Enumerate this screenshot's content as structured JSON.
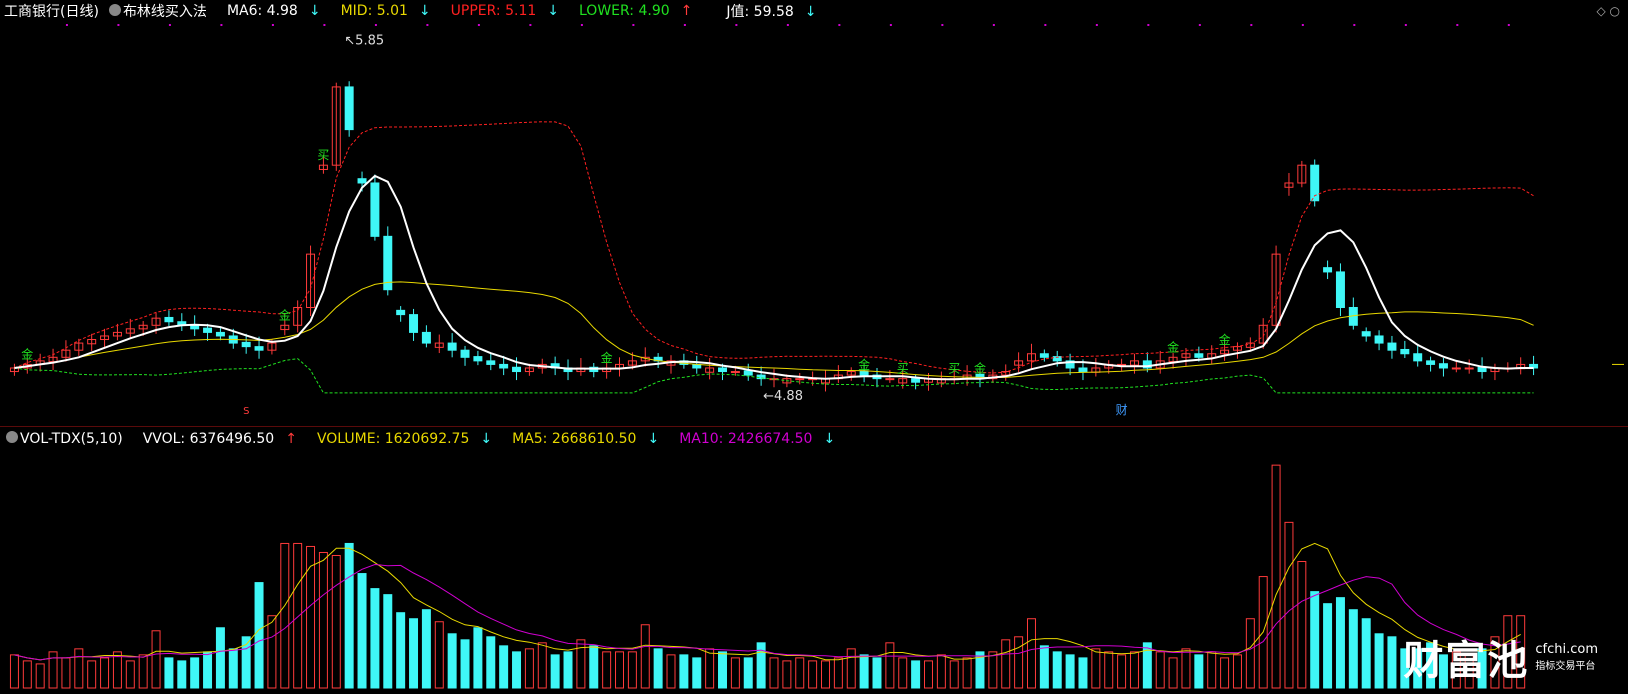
{
  "header": {
    "stock_name": "工商银行(日线)",
    "indicator": "布林线买入法",
    "ma6": {
      "label": "MA6: 4.98",
      "color": "#ffffff",
      "dir": "↓"
    },
    "mid": {
      "label": "MID: 5.01",
      "color": "#e8d800",
      "dir": "↓"
    },
    "upper": {
      "label": "UPPER: 5.11",
      "color": "#ff2020",
      "dir": "↓"
    },
    "lower": {
      "label": "LOWER: 4.90",
      "color": "#20e020",
      "dir": "↑"
    },
    "j": {
      "label": "J值: 59.58",
      "color": "#ffffff",
      "dir": "↓"
    }
  },
  "vol_header": {
    "name": "VOL-TDX(5,10)",
    "vvol": {
      "label": "VVOL: 6376496.50",
      "color": "#ffffff",
      "dir": "↑"
    },
    "volume": {
      "label": "VOLUME: 1620692.75",
      "color": "#e8d800",
      "dir": "↓"
    },
    "ma5": {
      "label": "MA5: 2668610.50",
      "color": "#e8d800",
      "dir": "↓"
    },
    "ma10": {
      "label": "MA10: 2426674.50",
      "color": "#d000d0",
      "dir": "↓"
    }
  },
  "annotations": {
    "high": "5.85",
    "low": "4.88",
    "signal_jin": "金",
    "signal_mai": "买",
    "signal_s": "S",
    "signal_cai": "财"
  },
  "watermark": {
    "logo": "财富池",
    "url": "cfchi.com",
    "sub": "指标交易平台"
  },
  "colors": {
    "up": "#ff3b3b",
    "down": "#3ff7f7",
    "ma6": "#ffffff",
    "mid": "#e8d800",
    "upper": "#ff2020",
    "lower": "#20e020",
    "vol_ma5": "#e8d800",
    "vol_ma10": "#d000d0"
  },
  "chart_data": {
    "type": "candlestick",
    "price_range": [
      4.84,
      5.88
    ],
    "close": [
      4.93,
      4.94,
      4.95,
      4.96,
      4.98,
      5.0,
      5.01,
      5.02,
      5.03,
      5.04,
      5.05,
      5.07,
      5.06,
      5.05,
      5.04,
      5.03,
      5.02,
      5.0,
      4.99,
      4.98,
      5.0,
      5.05,
      5.1,
      5.25,
      5.5,
      5.72,
      5.6,
      5.45,
      5.3,
      5.15,
      5.08,
      5.03,
      5.0,
      5.0,
      4.98,
      4.96,
      4.95,
      4.94,
      4.93,
      4.92,
      4.93,
      4.94,
      4.93,
      4.92,
      4.93,
      4.92,
      4.93,
      4.94,
      4.95,
      4.96,
      4.95,
      4.95,
      4.94,
      4.93,
      4.93,
      4.92,
      4.92,
      4.91,
      4.9,
      4.9,
      4.9,
      4.9,
      4.9,
      4.9,
      4.91,
      4.92,
      4.91,
      4.9,
      4.9,
      4.9,
      4.89,
      4.9,
      4.9,
      4.9,
      4.91,
      4.9,
      4.91,
      4.92,
      4.95,
      4.97,
      4.96,
      4.95,
      4.93,
      4.92,
      4.93,
      4.94,
      4.94,
      4.95,
      4.93,
      4.95,
      4.96,
      4.97,
      4.96,
      4.97,
      4.98,
      4.99,
      5.0,
      5.05,
      5.25,
      5.45,
      5.5,
      5.4,
      5.2,
      5.1,
      5.05,
      5.02,
      5.0,
      4.98,
      4.97,
      4.95,
      4.94,
      4.93,
      4.93,
      4.93,
      4.92,
      4.93,
      4.93,
      4.94,
      4.93
    ],
    "volume": [
      1100000,
      900000,
      800000,
      1200000,
      1000000,
      1300000,
      900000,
      1000000,
      1200000,
      900000,
      1100000,
      1900000,
      1000000,
      900000,
      1000000,
      1200000,
      2000000,
      1300000,
      1700000,
      3500000,
      2400000,
      4800000,
      4800000,
      4700000,
      4500000,
      4400000,
      4800000,
      3800000,
      3300000,
      3100000,
      2500000,
      2300000,
      2600000,
      2200000,
      1800000,
      1600000,
      2000000,
      1700000,
      1400000,
      1200000,
      1300000,
      1500000,
      1100000,
      1200000,
      1600000,
      1400000,
      1200000,
      1200000,
      1200000,
      2100000,
      1300000,
      1100000,
      1100000,
      1000000,
      1300000,
      1200000,
      1000000,
      1000000,
      1500000,
      1000000,
      900000,
      1000000,
      900000,
      900000,
      1000000,
      1300000,
      1100000,
      1000000,
      1500000,
      1000000,
      900000,
      900000,
      1100000,
      900000,
      1000000,
      1200000,
      1200000,
      1600000,
      1700000,
      2300000,
      1400000,
      1200000,
      1100000,
      1000000,
      1300000,
      1200000,
      1100000,
      1200000,
      1500000,
      1200000,
      1000000,
      1300000,
      1100000,
      1200000,
      1000000,
      1100000,
      2300000,
      3700000,
      7400000,
      5500000,
      4200000,
      3200000,
      2800000,
      3000000,
      2600000,
      2300000,
      1800000,
      1700000,
      1300000,
      1300000,
      1500000,
      1100000,
      1200000,
      1100000,
      1300000,
      1700000,
      2400000,
      2400000
    ]
  }
}
